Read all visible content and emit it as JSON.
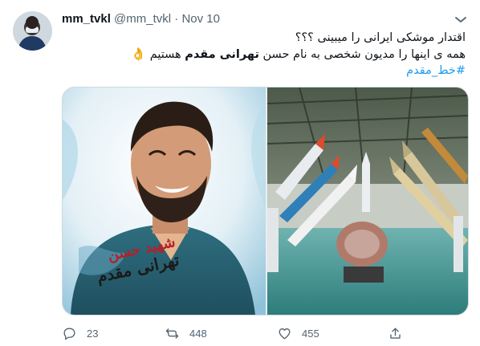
{
  "user": {
    "display_name": "mm_tvkl",
    "handle": "@mm_tvkl",
    "separator": "·",
    "time": "Nov 10"
  },
  "tweet": {
    "line1": "اقتدار موشکی ایرانی را میبینی ؟؟؟",
    "line2_start": "همه ی اینها را مدیون شخصی به نام حسن ",
    "line2_bold": "تهرانی مقدم",
    "line2_end": " هستیم",
    "line2_emoji": "👌",
    "hashtag": "#خط_مقدم"
  },
  "media": {
    "portrait_caption_line1": "شهید حسن",
    "portrait_caption_line2": "تهرانی مقدم"
  },
  "actions": {
    "reply_count": "23",
    "retweet_count": "448",
    "like_count": "455"
  },
  "icons": {
    "more": "more-icon",
    "reply": "reply-icon",
    "retweet": "retweet-icon",
    "like": "like-icon",
    "share": "share-icon"
  },
  "colors": {
    "hashtag": "#1d9bf0",
    "secondary_text": "#536471",
    "primary_text": "#0f1419",
    "border": "#cfd9de"
  }
}
